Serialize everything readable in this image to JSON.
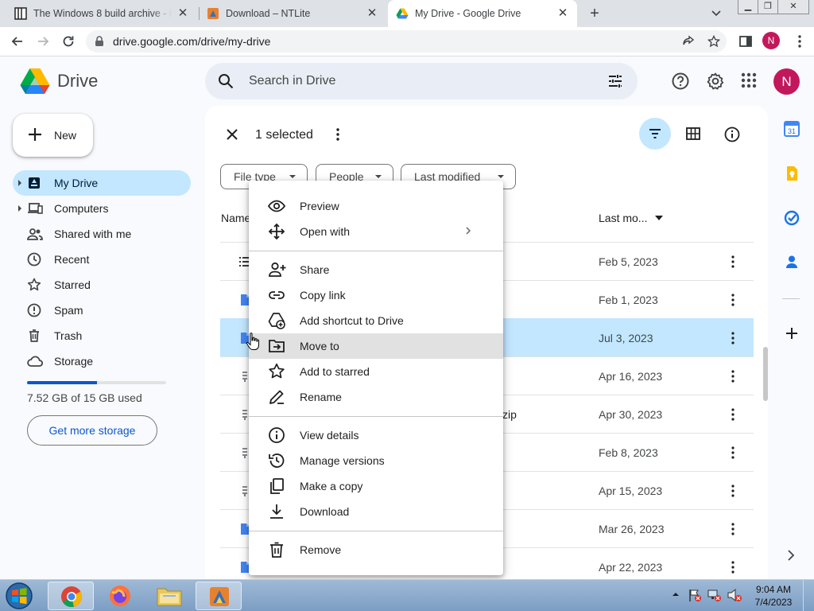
{
  "browser": {
    "tabs": [
      {
        "title": "The Windows 8 build archive - bu",
        "icon": "book-favicon",
        "active": false
      },
      {
        "title": "Download – NTLite",
        "icon": "ntlite-favicon",
        "active": false
      },
      {
        "title": "My Drive - Google Drive",
        "icon": "drive-favicon",
        "active": true
      }
    ],
    "url": "drive.google.com/drive/my-drive",
    "profile_initial": "N"
  },
  "drive": {
    "title": "Drive",
    "search_placeholder": "Search in Drive",
    "avatar_initial": "N",
    "new_label": "New",
    "nav": [
      {
        "label": "My Drive",
        "icon": "my-drive-icon",
        "active": true,
        "expandable": true
      },
      {
        "label": "Computers",
        "icon": "computers-icon",
        "active": false,
        "expandable": true
      },
      {
        "label": "Shared with me",
        "icon": "shared-icon",
        "active": false,
        "expandable": false
      },
      {
        "label": "Recent",
        "icon": "clock-icon",
        "active": false,
        "expandable": false
      },
      {
        "label": "Starred",
        "icon": "star-icon",
        "active": false,
        "expandable": false
      },
      {
        "label": "Spam",
        "icon": "spam-icon",
        "active": false,
        "expandable": false
      },
      {
        "label": "Trash",
        "icon": "trash-icon",
        "active": false,
        "expandable": false
      },
      {
        "label": "Storage",
        "icon": "cloud-icon",
        "active": false,
        "expandable": false
      }
    ],
    "storage": {
      "used_text": "7.52 GB of 15 GB used",
      "used_fraction": 0.5,
      "cta": "Get more storage"
    },
    "selection": {
      "count_text": "1 selected"
    },
    "filters": [
      "File type",
      "People",
      "Last modified"
    ],
    "columns": {
      "name": "Name",
      "last_modified": "Last mo..."
    },
    "rows": [
      {
        "date": "Feb 5, 2023",
        "icon": "list-icon",
        "name_tail": "",
        "selected": false
      },
      {
        "date": "Feb 1, 2023",
        "icon": "doc-icon",
        "name_tail": "",
        "selected": false
      },
      {
        "date": "Jul 3, 2023",
        "icon": "doc-icon",
        "name_tail": "",
        "selected": true
      },
      {
        "date": "Apr 16, 2023",
        "icon": "zip-icon",
        "name_tail": "",
        "selected": false
      },
      {
        "date": "Apr 30, 2023",
        "icon": "zip-icon",
        "name_tail": "zip",
        "selected": false
      },
      {
        "date": "Feb 8, 2023",
        "icon": "zip-icon",
        "name_tail": "",
        "selected": false
      },
      {
        "date": "Apr 15, 2023",
        "icon": "zip-icon",
        "name_tail": "",
        "selected": false
      },
      {
        "date": "Mar 26, 2023",
        "icon": "doc-icon",
        "name_tail": "",
        "selected": false
      },
      {
        "date": "Apr 22, 2023",
        "icon": "doc-icon",
        "name_tail": "",
        "selected": false
      }
    ],
    "context_menu": [
      {
        "label": "Preview",
        "icon": "eye-icon"
      },
      {
        "label": "Open with",
        "icon": "move-arrows-icon",
        "submenu": true
      },
      {
        "label": "Share",
        "icon": "person-add-icon"
      },
      {
        "label": "Copy link",
        "icon": "link-icon"
      },
      {
        "label": "Add shortcut to Drive",
        "icon": "drive-shortcut-icon"
      },
      {
        "label": "Move to",
        "icon": "folder-move-icon",
        "hover": true
      },
      {
        "label": "Add to starred",
        "icon": "star-icon"
      },
      {
        "label": "Rename",
        "icon": "pencil-icon"
      },
      {
        "label": "View details",
        "icon": "info-icon"
      },
      {
        "label": "Manage versions",
        "icon": "history-icon"
      },
      {
        "label": "Make a copy",
        "icon": "copy-icon"
      },
      {
        "label": "Download",
        "icon": "download-icon"
      },
      {
        "label": "Remove",
        "icon": "trash-icon"
      }
    ]
  },
  "side_panel": {
    "calendar_day": "31",
    "icons": [
      "calendar-icon",
      "keep-icon",
      "tasks-icon",
      "contacts-icon",
      "add-icon",
      "chevron-right-icon"
    ]
  },
  "taskbar": {
    "time": "9:04 AM",
    "date": "7/4/2023",
    "apps": [
      "chrome-icon",
      "firefox-icon",
      "explorer-icon",
      "ntlite-icon"
    ]
  },
  "colors": {
    "accent": "#0b57d0",
    "selection": "#c2e7ff",
    "avatar": "#c2185b",
    "surface": "#f8fafd"
  }
}
